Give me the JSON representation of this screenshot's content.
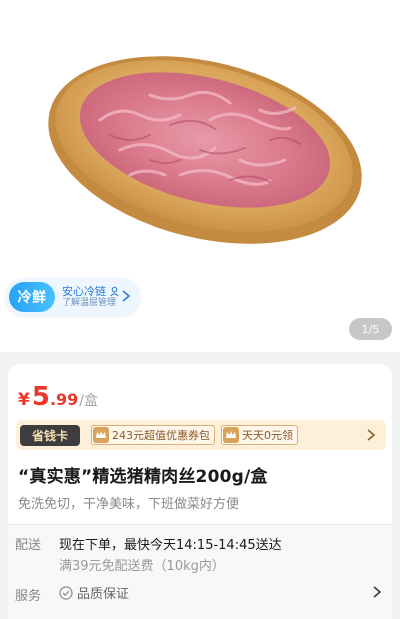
{
  "gallery": {
    "image_alt": "shredded pork on wooden plate",
    "counter": "1/5"
  },
  "cold_chain": {
    "pill": "冷鲜",
    "title": "安心冷链",
    "subtitle": "了解温层管理",
    "icon": "shield-person-icon"
  },
  "price": {
    "currency": "¥",
    "integer": "5",
    "decimal": ".99",
    "unit": "/盒",
    "color": "#e8372b"
  },
  "money_card": {
    "tag": "省钱卡",
    "coupon1": "243元超值优惠券包",
    "coupon2": "天天0元领"
  },
  "product": {
    "title": "“真实惠”精选猪精肉丝200g/盒",
    "subtitle": "免洗免切，干净美味，下班做菜好方便"
  },
  "shipping": {
    "label": "配送",
    "main": "现在下单，最快今天14:15-14:45送达",
    "sub": "满39元免配送费（10kg内）"
  },
  "service": {
    "label": "服务",
    "item": "品质保证"
  }
}
